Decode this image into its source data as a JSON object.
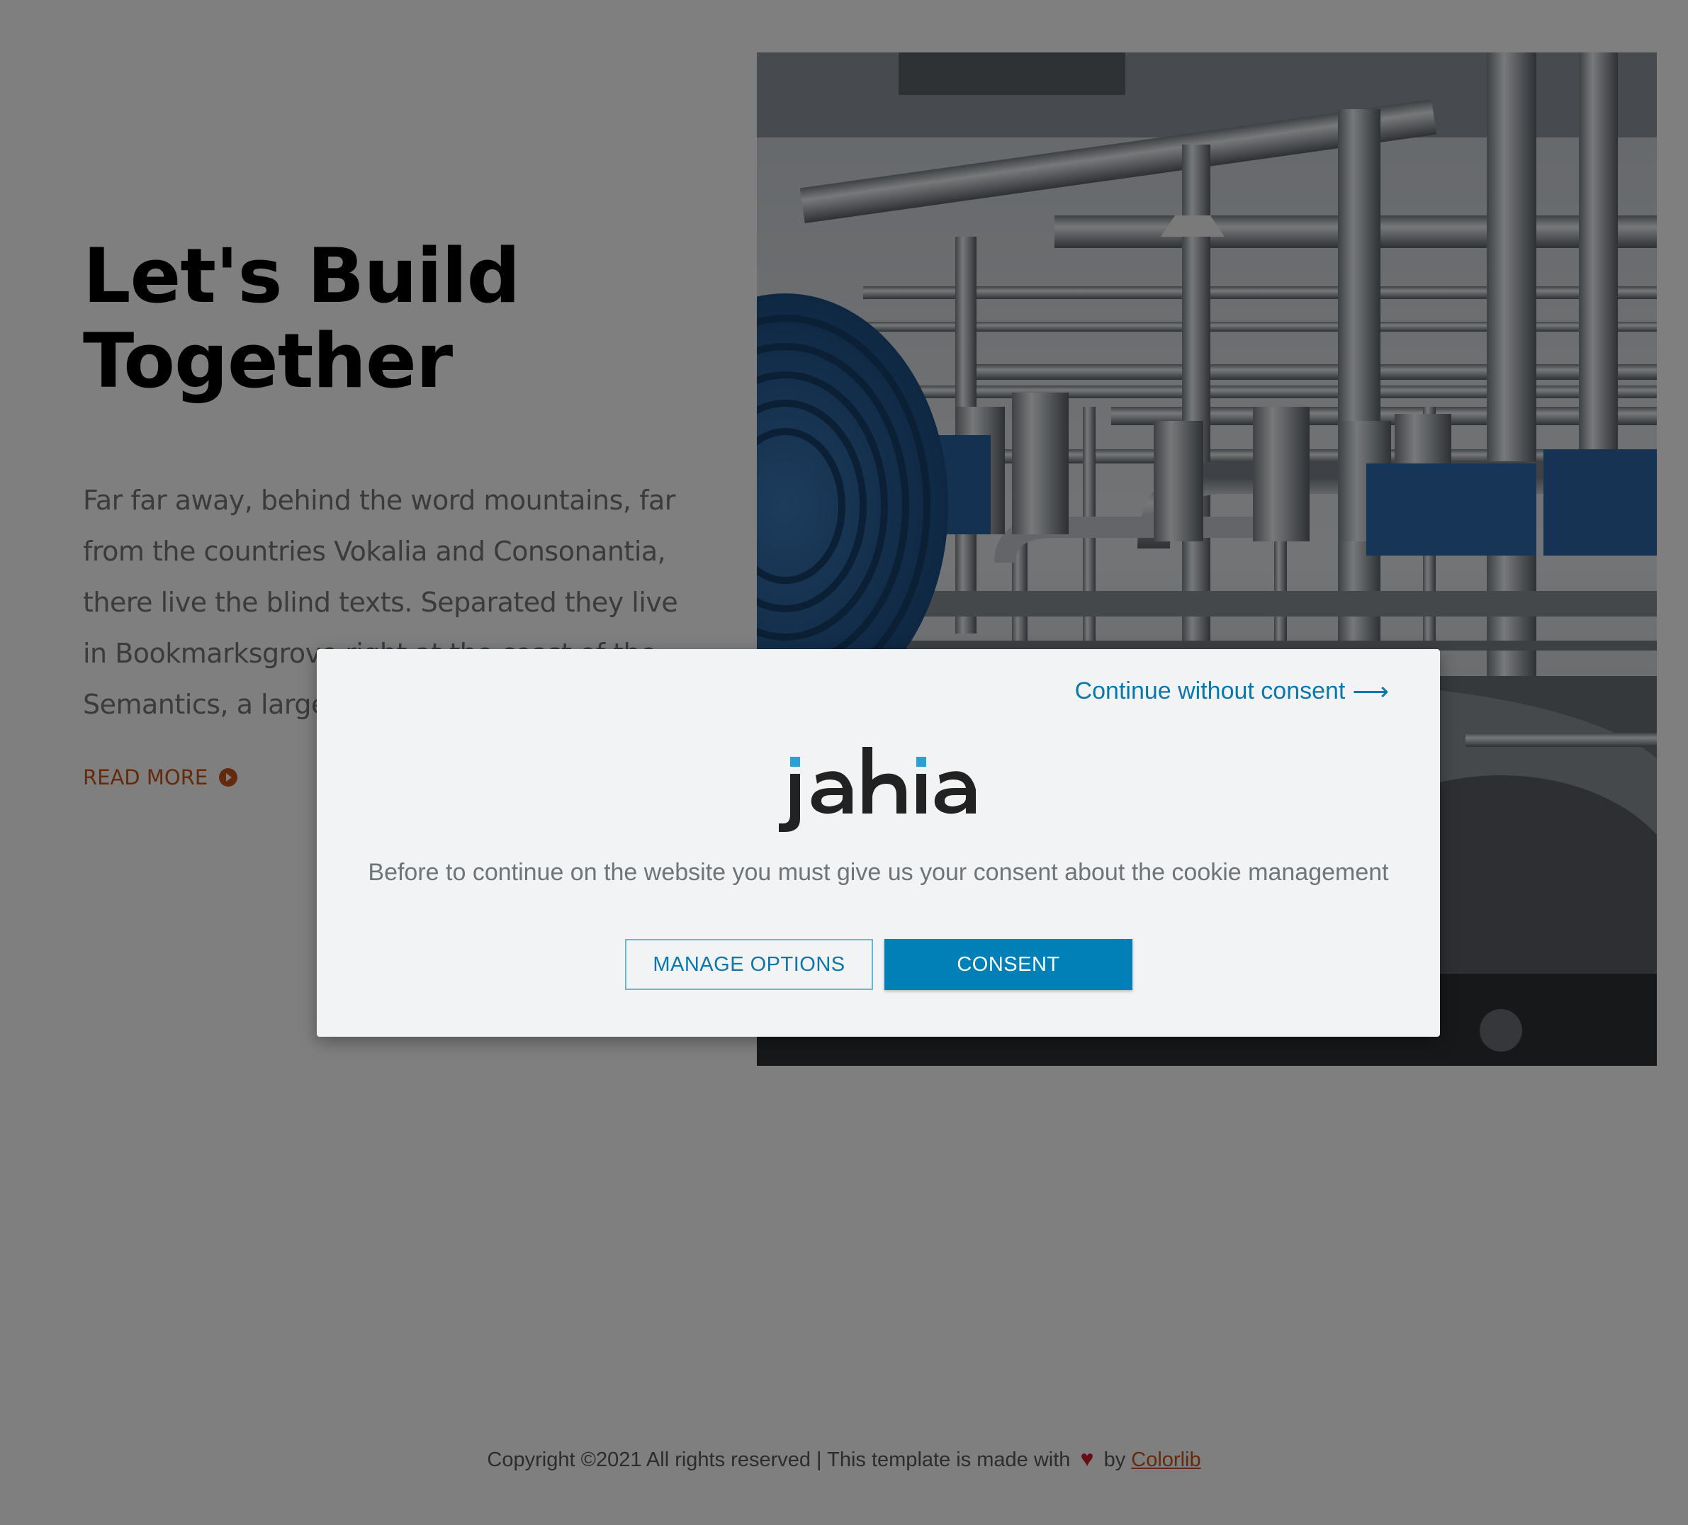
{
  "hero": {
    "title_line1": "Let's Build",
    "title_line2": "Together",
    "body": "Far far away, behind the word mountains, far from the countries Vokalia and Consonantia, there live the blind texts. Separated they live in Bookmarksgrove right at the coast of the Semantics, a large",
    "read_more_label": "READ MORE"
  },
  "footer": {
    "prefix": "Copyright ©2021 All rights reserved | This template is made with",
    "heart_icon": "heart-icon",
    "by": "by",
    "brand": "Colorlib"
  },
  "consent_modal": {
    "skip_label": "Continue without consent",
    "skip_icon": "arrow-right-icon",
    "logo_text": "jahia",
    "message": "Before to continue on the website you must give us your consent about the cookie management",
    "manage_label": "MANAGE OPTIONS",
    "consent_label": "CONSENT"
  },
  "colors": {
    "accent": "#0080b7",
    "link": "#c8551a",
    "overlay": "rgba(0,0,0,0.5)",
    "modal_bg": "#f1f3f5"
  }
}
